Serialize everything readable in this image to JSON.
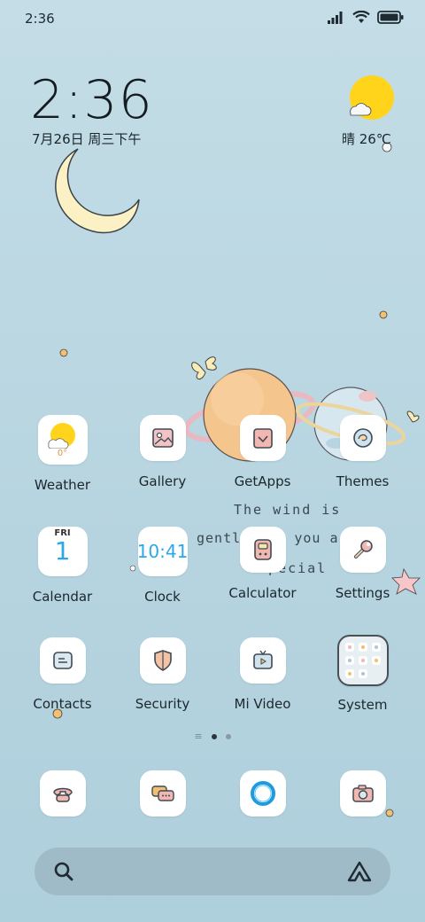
{
  "status_bar": {
    "time": "2:36",
    "battery_icon": "battery-icon",
    "wifi_icon": "wifi-icon",
    "signal_icon": "signal-icon"
  },
  "clock_widget": {
    "time": "2:36",
    "date": "7月26日 周三下午"
  },
  "weather_widget": {
    "condition_temp": "晴 26℃",
    "icon": "sun-cloud-icon"
  },
  "wallpaper_text": {
    "line1": "The wind is",
    "line2": "gentle and you are",
    "line3": "special"
  },
  "apps": [
    {
      "label": "Weather",
      "icon": "weather-icon",
      "badge": "0°"
    },
    {
      "label": "Gallery",
      "icon": "gallery-icon"
    },
    {
      "label": "GetApps",
      "icon": "getapps-icon"
    },
    {
      "label": "Themes",
      "icon": "themes-icon"
    },
    {
      "label": "Calendar",
      "icon": "calendar-icon",
      "day": "FRI",
      "date": "1"
    },
    {
      "label": "Clock",
      "icon": "clock-icon",
      "time": "10:41"
    },
    {
      "label": "Calculator",
      "icon": "calculator-icon"
    },
    {
      "label": "Settings",
      "icon": "settings-icon"
    },
    {
      "label": "Contacts",
      "icon": "contacts-icon"
    },
    {
      "label": "Security",
      "icon": "security-icon"
    },
    {
      "label": "Mi Video",
      "icon": "video-icon"
    },
    {
      "label": "System",
      "icon": "folder-icon"
    }
  ],
  "dock": [
    {
      "icon": "phone-icon"
    },
    {
      "icon": "messages-icon"
    },
    {
      "icon": "browser-icon"
    },
    {
      "icon": "camera-icon"
    }
  ],
  "page_indicator": {
    "pages": 2,
    "active": 0
  },
  "search": {
    "icon": "search-icon",
    "assistant_icon": "assistant-icon"
  },
  "colors": {
    "accent": "#2aa8e8",
    "sun": "#ffd41a",
    "icon_outline": "#3d4a52"
  }
}
